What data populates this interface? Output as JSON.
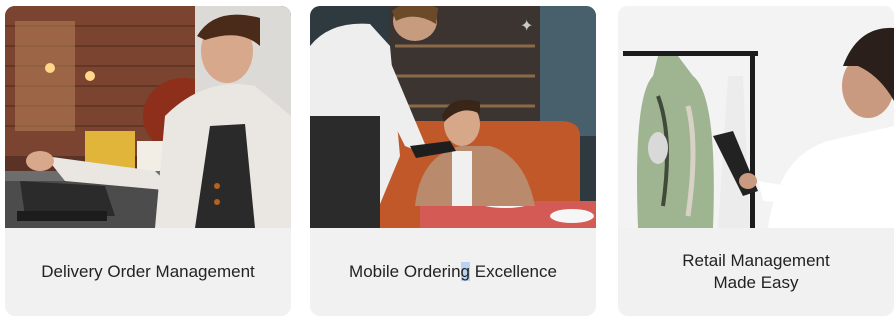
{
  "cards": [
    {
      "title": "Delivery Order Management",
      "image": "barista-using-pos-terminal-photo"
    },
    {
      "title_parts": [
        "Mobile Orderin",
        "g",
        " Excellence"
      ],
      "image": "waiter-taking-order-with-handheld-pos-photo"
    },
    {
      "title_lines": [
        "Retail Management",
        "Made Easy"
      ],
      "image": "shop-assistant-scanning-clothing-tag-photo"
    }
  ],
  "colors": {
    "card_bg": "#f1f1f1",
    "text": "#222222",
    "selection_highlight": "#b9d3f0"
  }
}
